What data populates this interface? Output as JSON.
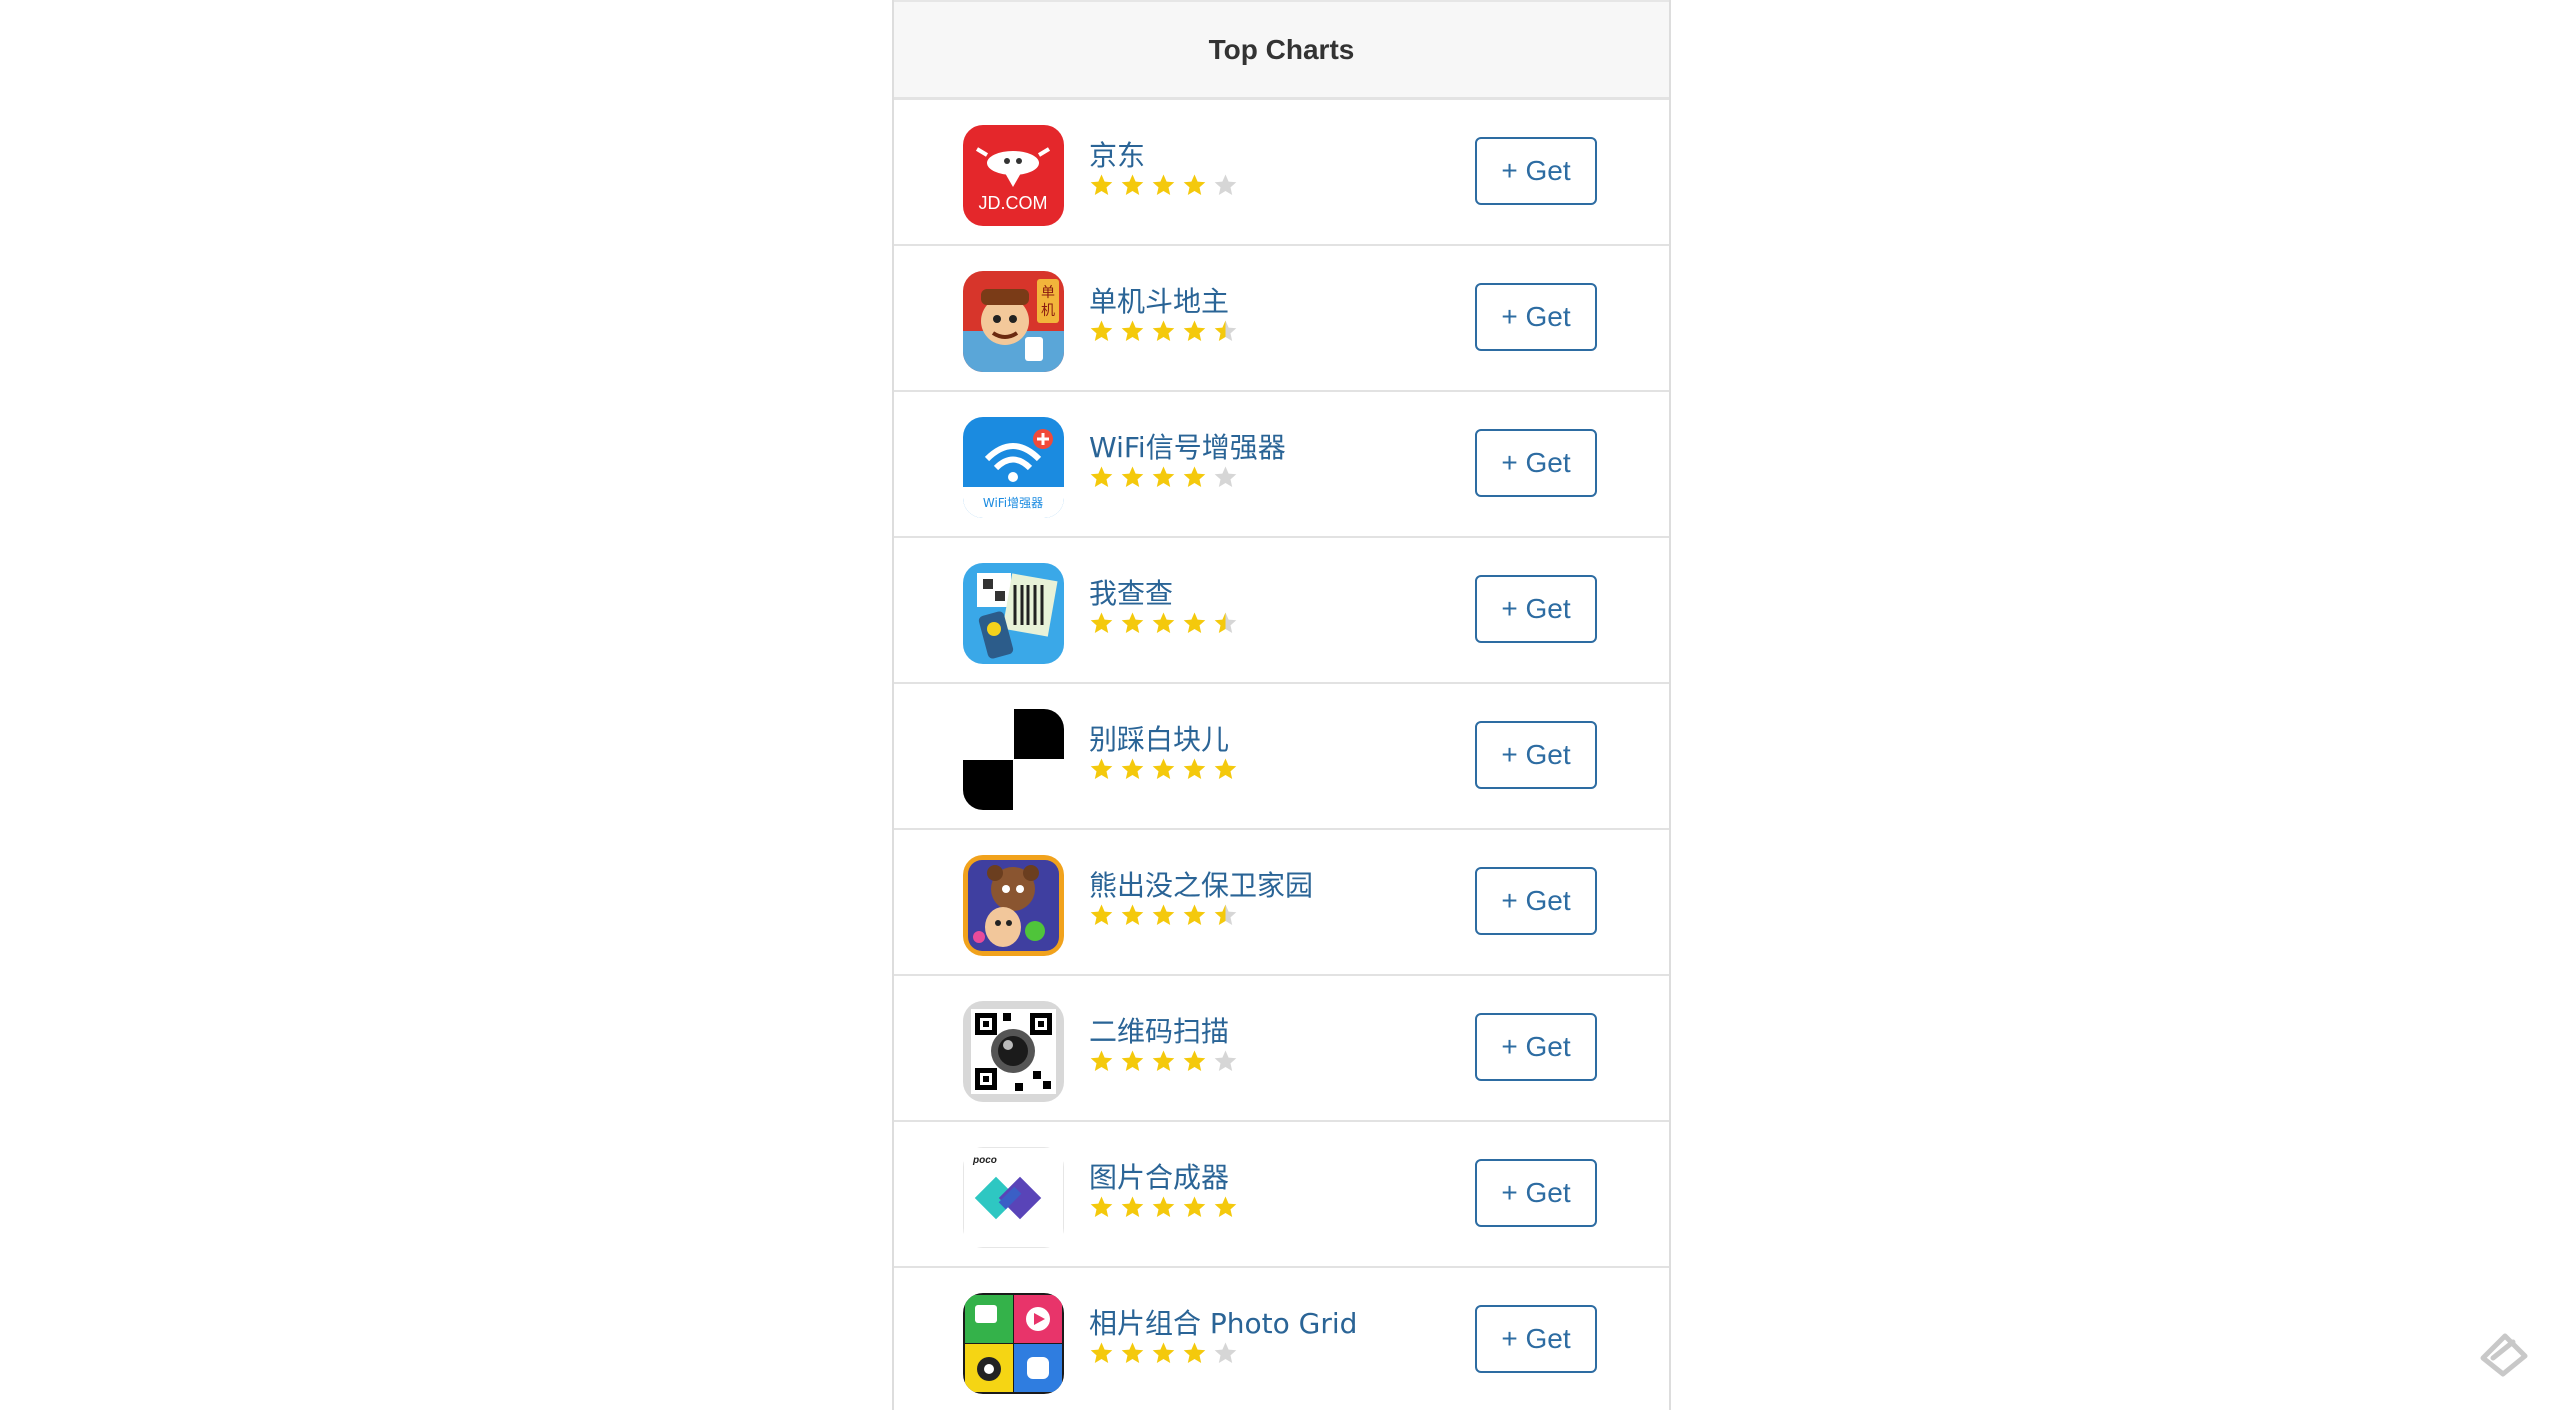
{
  "header": {
    "title": "Top Charts"
  },
  "colors": {
    "star_on": "#f4c90c",
    "star_off": "#d6d6d6",
    "link": "#2a6496",
    "button": "#2d6ca2"
  },
  "apps": [
    {
      "name": "京东",
      "rating": 4,
      "button": "+ Get",
      "icon": "jd-icon",
      "icon_text": "JD.COM"
    },
    {
      "name": "单机斗地主",
      "rating": 4.5,
      "button": "+ Get",
      "icon": "doudizhu-icon",
      "icon_text": "单机"
    },
    {
      "name": "WiFi信号增强器",
      "rating": 4,
      "button": "+ Get",
      "icon": "wifi-icon",
      "icon_text": "WiFi增强器"
    },
    {
      "name": "我查查",
      "rating": 4.5,
      "button": "+ Get",
      "icon": "barcode-scanner-icon"
    },
    {
      "name": "别踩白块儿",
      "rating": 5,
      "button": "+ Get",
      "icon": "piano-tiles-icon"
    },
    {
      "name": "熊出没之保卫家园",
      "rating": 4.5,
      "button": "+ Get",
      "icon": "bear-game-icon"
    },
    {
      "name": "二维码扫描",
      "rating": 4,
      "button": "+ Get",
      "icon": "qr-scanner-icon"
    },
    {
      "name": "图片合成器",
      "rating": 5,
      "button": "+ Get",
      "icon": "poco-icon",
      "icon_text": "poco"
    },
    {
      "name": "相片组合 Photo Grid",
      "rating": 4,
      "button": "+ Get",
      "icon": "photo-grid-icon"
    }
  ]
}
